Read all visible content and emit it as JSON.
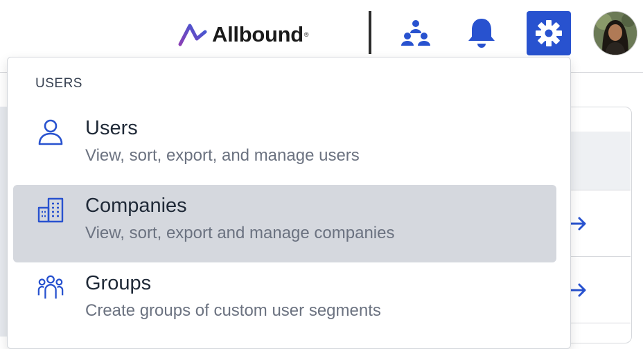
{
  "header": {
    "brand": {
      "name": "Allbound",
      "registered_mark": "®"
    },
    "icons": {
      "org_chart": "org-chart-icon",
      "notifications": "bell-icon",
      "settings": "gear-icon",
      "avatar": "user-avatar"
    },
    "accent_color": "#2852cf"
  },
  "dropdown": {
    "section_label": "USERS",
    "items": [
      {
        "title": "Users",
        "description": "View, sort, export, and manage users",
        "icon": "user-icon",
        "active": false
      },
      {
        "title": "Companies",
        "description": "View, sort, export and manage companies",
        "icon": "buildings-icon",
        "active": true
      },
      {
        "title": "Groups",
        "description": "Create groups of custom user segments",
        "icon": "group-icon",
        "active": false
      }
    ]
  }
}
